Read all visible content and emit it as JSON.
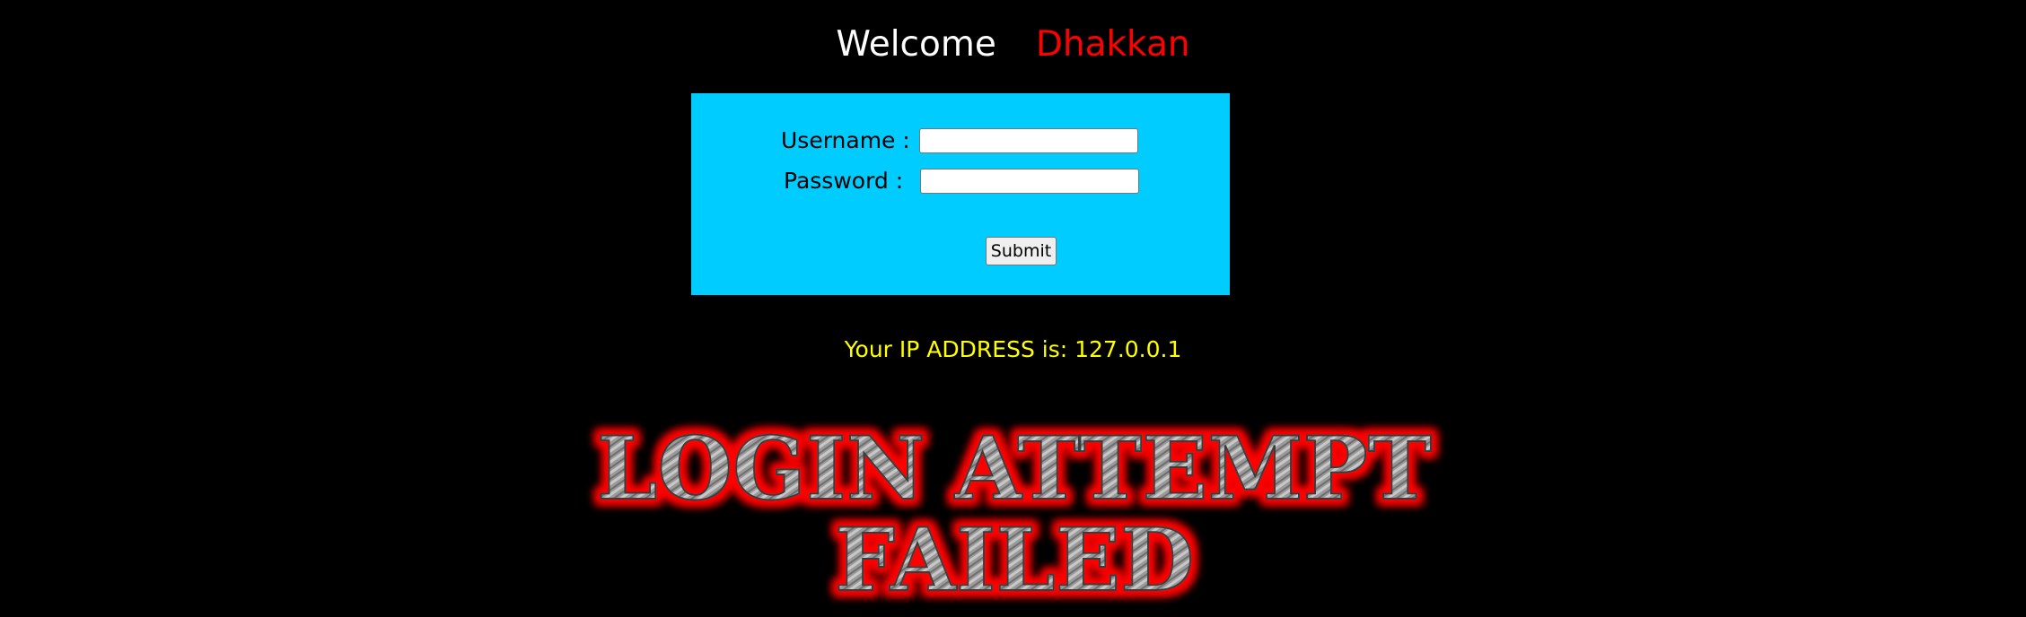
{
  "header": {
    "welcome": "Welcome",
    "username": "Dhakkan",
    "color_welcome": "#ffffff",
    "color_username": "#ff0000"
  },
  "login_form": {
    "background": "#00ccff",
    "username_label": "Username :",
    "username_value": "",
    "password_label": "Password :",
    "password_value": "",
    "submit_label": "Submit"
  },
  "ip_info": {
    "label": "Your IP ADDRESS is:",
    "value": "127.0.0.1",
    "color": "#ffff00"
  },
  "banner": {
    "line1": "LOGIN ATTEMPT",
    "line2": "FAILED",
    "glow_color": "#ff0000"
  }
}
